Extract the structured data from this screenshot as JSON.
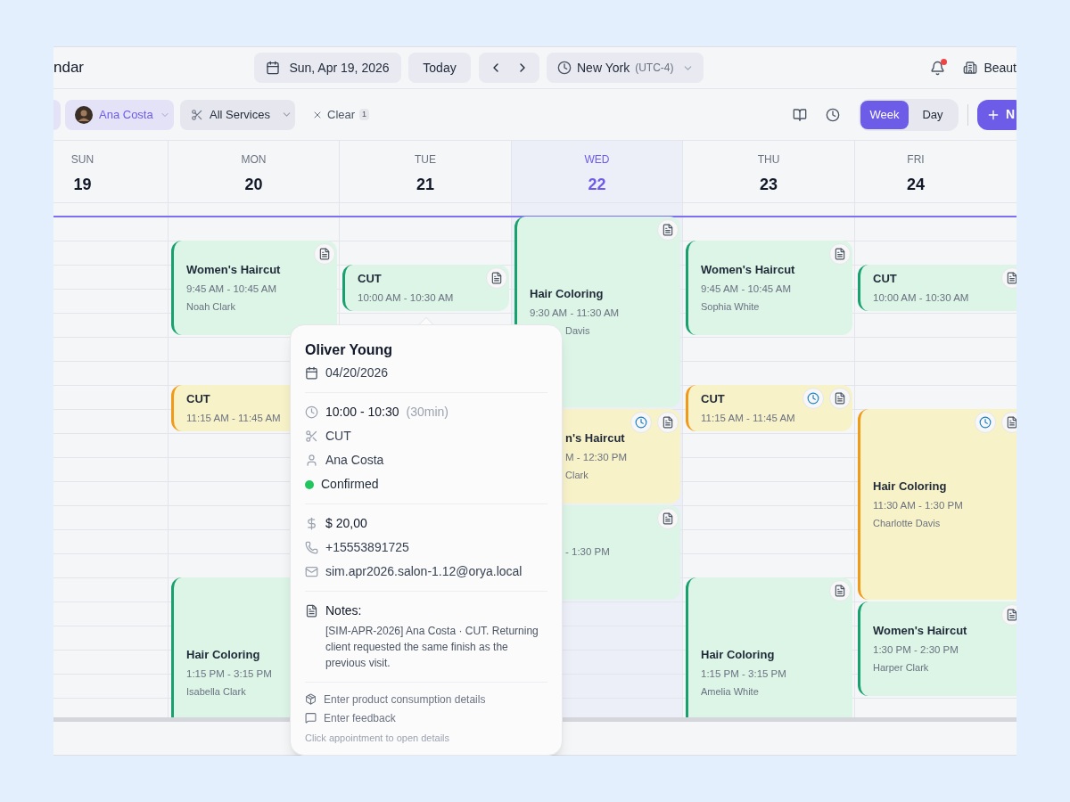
{
  "header": {
    "title": "ndar",
    "date": "Sun, Apr 19, 2026",
    "today": "Today",
    "timezone": "New York",
    "utc": "(UTC-4)",
    "notifications_unread": true,
    "business": "Beaut"
  },
  "filters": {
    "staff": "Ana Costa",
    "services": "All Services",
    "clear": "Clear",
    "clear_count": "1"
  },
  "views": [
    {
      "label": "Week",
      "selected": true
    },
    {
      "label": "Day",
      "selected": false
    }
  ],
  "new_button": "N",
  "days": [
    {
      "name": "SUN",
      "date": "19",
      "selected": false
    },
    {
      "name": "MON",
      "date": "20",
      "selected": false,
      "events": [
        {
          "kind": "confirmed",
          "title": "Women's Haircut",
          "time": "9:45 AM - 10:45 AM",
          "client": "Noah Clark",
          "note": true
        },
        {
          "kind": "pending",
          "title": "CUT",
          "time": "11:15 AM - 11:45 AM"
        },
        {
          "kind": "confirmed",
          "title": "Hair Coloring",
          "time": "1:15 PM - 3:15 PM",
          "client": "Isabella Clark"
        }
      ]
    },
    {
      "name": "TUE",
      "date": "21",
      "selected": false,
      "events": [
        {
          "kind": "confirmed",
          "title": "CUT",
          "time": "10:00 AM - 10:30 AM",
          "note": true
        }
      ]
    },
    {
      "name": "WED",
      "date": "22",
      "selected": true,
      "events": [
        {
          "kind": "confirmed",
          "title": "Hair Coloring",
          "time": "9:30 AM - 11:30 AM",
          "client": "Davis",
          "note": true,
          "client_covered": true
        },
        {
          "kind": "pending",
          "title": "n's Haircut",
          "time": "M - 12:30 PM",
          "client": "Clark",
          "reminder": true,
          "note": true,
          "covered": true
        },
        {
          "kind": "confirmed",
          "time": "- 1:30 PM",
          "note": true,
          "covered": true
        }
      ]
    },
    {
      "name": "THU",
      "date": "23",
      "selected": false,
      "events": [
        {
          "kind": "confirmed",
          "title": "Women's Haircut",
          "time": "9:45 AM - 10:45 AM",
          "client": "Sophia White",
          "note": true
        },
        {
          "kind": "pending",
          "title": "CUT",
          "time": "11:15 AM - 11:45 AM",
          "reminder": true,
          "note": true
        },
        {
          "kind": "confirmed",
          "title": "Hair Coloring",
          "time": "1:15 PM - 3:15 PM",
          "client": "Amelia White",
          "note": true
        }
      ]
    },
    {
      "name": "FRI",
      "date": "24",
      "selected": false,
      "events": [
        {
          "kind": "confirmed",
          "title": "CUT",
          "time": "10:00 AM - 10:30 AM",
          "note": true
        },
        {
          "kind": "pending",
          "title": "Hair Coloring",
          "time": "11:30 AM - 1:30 PM",
          "client": "Charlotte Davis",
          "reminder": true,
          "note": true
        },
        {
          "kind": "confirmed",
          "title": "Women's Haircut",
          "time": "1:30 PM - 2:30 PM",
          "client": "Harper Clark",
          "note": true
        }
      ]
    }
  ],
  "popover": {
    "client": "Oliver Young",
    "date": "04/20/2026",
    "time": "10:00 - 10:30",
    "duration": "(30min)",
    "service": "CUT",
    "staff": "Ana Costa",
    "status": {
      "label": "Confirmed",
      "kind": "confirmed"
    },
    "price": "$ 20,00",
    "phone": "+15553891725",
    "email": "sim.apr2026.salon-1.12@orya.local",
    "notes_label": "Notes:",
    "notes": "[SIM-APR-2026] Ana Costa · CUT. Returning client requested the same finish as the previous visit.",
    "actions": [
      {
        "kind": "products",
        "label": "Enter product consumption details"
      },
      {
        "kind": "feedback",
        "label": "Enter feedback"
      }
    ],
    "hint": "Click appointment to open details"
  }
}
